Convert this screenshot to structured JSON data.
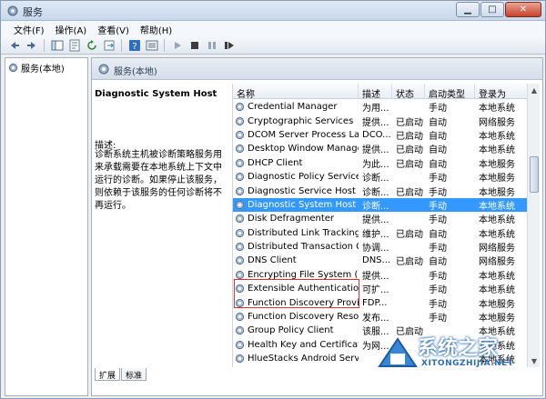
{
  "window": {
    "title": "服务"
  },
  "menu": [
    "文件(F)",
    "操作(A)",
    "查看(V)",
    "帮助(H)"
  ],
  "tree": {
    "root": "服务(本地)"
  },
  "pane": {
    "header": "服务(本地)",
    "selected_title": "Diagnostic System Host",
    "desc_label": "描述:",
    "desc_text": "诊断系统主机被诊断策略服务用来承载需要在本地系统上下文中运行的诊断。如果停止该服务，则依赖于该服务的任何诊断将不再运行。"
  },
  "columns": [
    "名称",
    "描述",
    "状态",
    "启动类型",
    "登录为"
  ],
  "services": [
    {
      "name": "Credential Manager",
      "desc": "为用...",
      "status": "",
      "type": "手动",
      "logon": "本地系统"
    },
    {
      "name": "Cryptographic Services",
      "desc": "提供...",
      "status": "已启动",
      "type": "自动",
      "logon": "网络服务"
    },
    {
      "name": "DCOM Server Process Lau...",
      "desc": "DCO...",
      "status": "已启动",
      "type": "自动",
      "logon": "本地系统"
    },
    {
      "name": "Desktop Window Manage...",
      "desc": "提供...",
      "status": "已启动",
      "type": "自动",
      "logon": "本地系统"
    },
    {
      "name": "DHCP Client",
      "desc": "为此...",
      "status": "已启动",
      "type": "自动",
      "logon": "本地服务"
    },
    {
      "name": "Diagnostic Policy Service",
      "desc": "诊断...",
      "status": "",
      "type": "手动",
      "logon": "本地服务"
    },
    {
      "name": "Diagnostic Service Host",
      "desc": "诊断...",
      "status": "已启动",
      "type": "手动",
      "logon": "本地服务"
    },
    {
      "name": "Diagnostic System Host",
      "desc": "诊断...",
      "status": "",
      "type": "手动",
      "logon": "本地系统",
      "selected": true
    },
    {
      "name": "Disk Defragmenter",
      "desc": "提供...",
      "status": "",
      "type": "手动",
      "logon": "本地系统"
    },
    {
      "name": "Distributed Link Tracking ...",
      "desc": "维护...",
      "status": "已启动",
      "type": "自动",
      "logon": "本地系统"
    },
    {
      "name": "Distributed Transaction Co...",
      "desc": "协调...",
      "status": "",
      "type": "手动",
      "logon": "网络服务"
    },
    {
      "name": "DNS Client",
      "desc": "DNS...",
      "status": "已启动",
      "type": "自动",
      "logon": "网络服务"
    },
    {
      "name": "Encrypting File System (EFS)",
      "desc": "提供...",
      "status": "",
      "type": "手动",
      "logon": "本地系统"
    },
    {
      "name": "Extensible Authentication P...",
      "desc": "可扩...",
      "status": "",
      "type": "手动",
      "logon": "本地系统"
    },
    {
      "name": "Function Discovery Provide...",
      "desc": "FDP...",
      "status": "",
      "type": "手动",
      "logon": "本地服务"
    },
    {
      "name": "Function Discovery Resour...",
      "desc": "发布...",
      "status": "",
      "type": "手动",
      "logon": "本地服务"
    },
    {
      "name": "Group Policy Client",
      "desc": "该服...",
      "status": "已启动",
      "type": "",
      "logon": "本地系统"
    },
    {
      "name": "Health Key and Certificate ...",
      "desc": "为网...",
      "status": "",
      "type": "",
      "logon": "本地系统"
    },
    {
      "name": "HlueStacks Android Service",
      "desc": "",
      "status": "",
      "type": "",
      "logon": "本地系统"
    }
  ],
  "tabs": [
    "扩展",
    "标准"
  ],
  "watermark": {
    "text": "系统之家",
    "sub": "XITONGZHIJIA.NET"
  }
}
